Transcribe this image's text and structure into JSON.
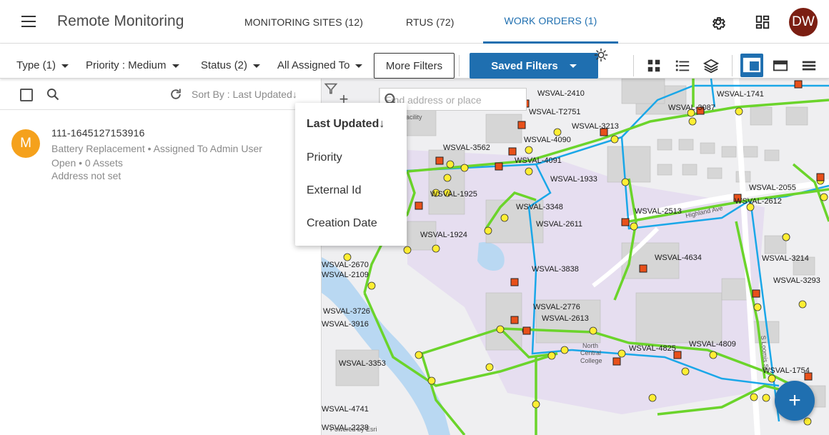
{
  "header": {
    "app_title": "Remote Monitoring",
    "tabs": [
      {
        "label": "MONITORING SITES (12)",
        "active": false
      },
      {
        "label": "RTUS (72)",
        "active": false
      },
      {
        "label": "WORK ORDERS (1)",
        "active": true
      }
    ],
    "user_initials": "DW",
    "icons": [
      "menu-icon",
      "gear-icon",
      "dashboard-icon"
    ]
  },
  "filters": {
    "type": "Type (1)",
    "priority": "Priority : Medium",
    "status": "Status (2)",
    "assigned": "All Assigned To",
    "more_filters": "More Filters",
    "saved_filters": "Saved Filters",
    "icons": [
      "grid-view-icon",
      "list-view-icon",
      "layers-icon",
      "split-view-icon",
      "map-view-icon",
      "table-view-icon"
    ]
  },
  "list": {
    "sort_label": "Sort By : Last Updated",
    "sort_arrow": "↓",
    "items": [
      {
        "avatar": "M",
        "id": "111-1645127153916",
        "line1": "Battery Replacement • Assigned To Admin User",
        "line2": "Open • 0 Assets",
        "line3": "Address not set"
      }
    ]
  },
  "sort_menu": {
    "options": [
      "Last Updated↓",
      "Priority",
      "External Id",
      "Creation Date"
    ],
    "selected": "Last Updated↓"
  },
  "map": {
    "search_placeholder": "Find address or place",
    "attribution": "Powered by Esri",
    "places": [
      "North Central College",
      "Facility"
    ],
    "streets": [
      "Loomis St",
      "Highland Ave"
    ],
    "labels": [
      "WSVAL-2410",
      "WSVAL-1741",
      "WSVAL-T2751",
      "WSVAL-3087",
      "WSVAL-3213",
      "WSVAL-4090",
      "WSVAL-4091",
      "WSVAL-3562",
      "WSVAL-1933",
      "WSVAL-1925",
      "WSVAL-3348",
      "WSVAL-2611",
      "WSVAL-2513",
      "WSVAL-2055",
      "WSVAL-2612",
      "WSVAL-1924",
      "WSVAL-4634",
      "WSVAL-3214",
      "WSVAL-2670",
      "WSVAL-2109",
      "WSVAL-3838",
      "WSVAL-3293",
      "WSVAL-2776",
      "WSVAL-2613",
      "WSVAL-3726",
      "WSVAL-3916",
      "WSVAL-4825",
      "WSVAL-4809",
      "WSVAL-3353",
      "WSVAL-1754",
      "WSVAL-4741",
      "WSVAL-2238"
    ],
    "colors": {
      "main_line": "#6bd42b",
      "service_line": "#1aa7e8",
      "valve": "#ffee33",
      "hydrant": "#e8501a",
      "campus": "#e9e2ef"
    }
  },
  "fab_label": "+",
  "colors": {
    "accent": "#1f6fb0",
    "avatar_user": "#7b1e12",
    "avatar_item": "#f5a11c"
  }
}
